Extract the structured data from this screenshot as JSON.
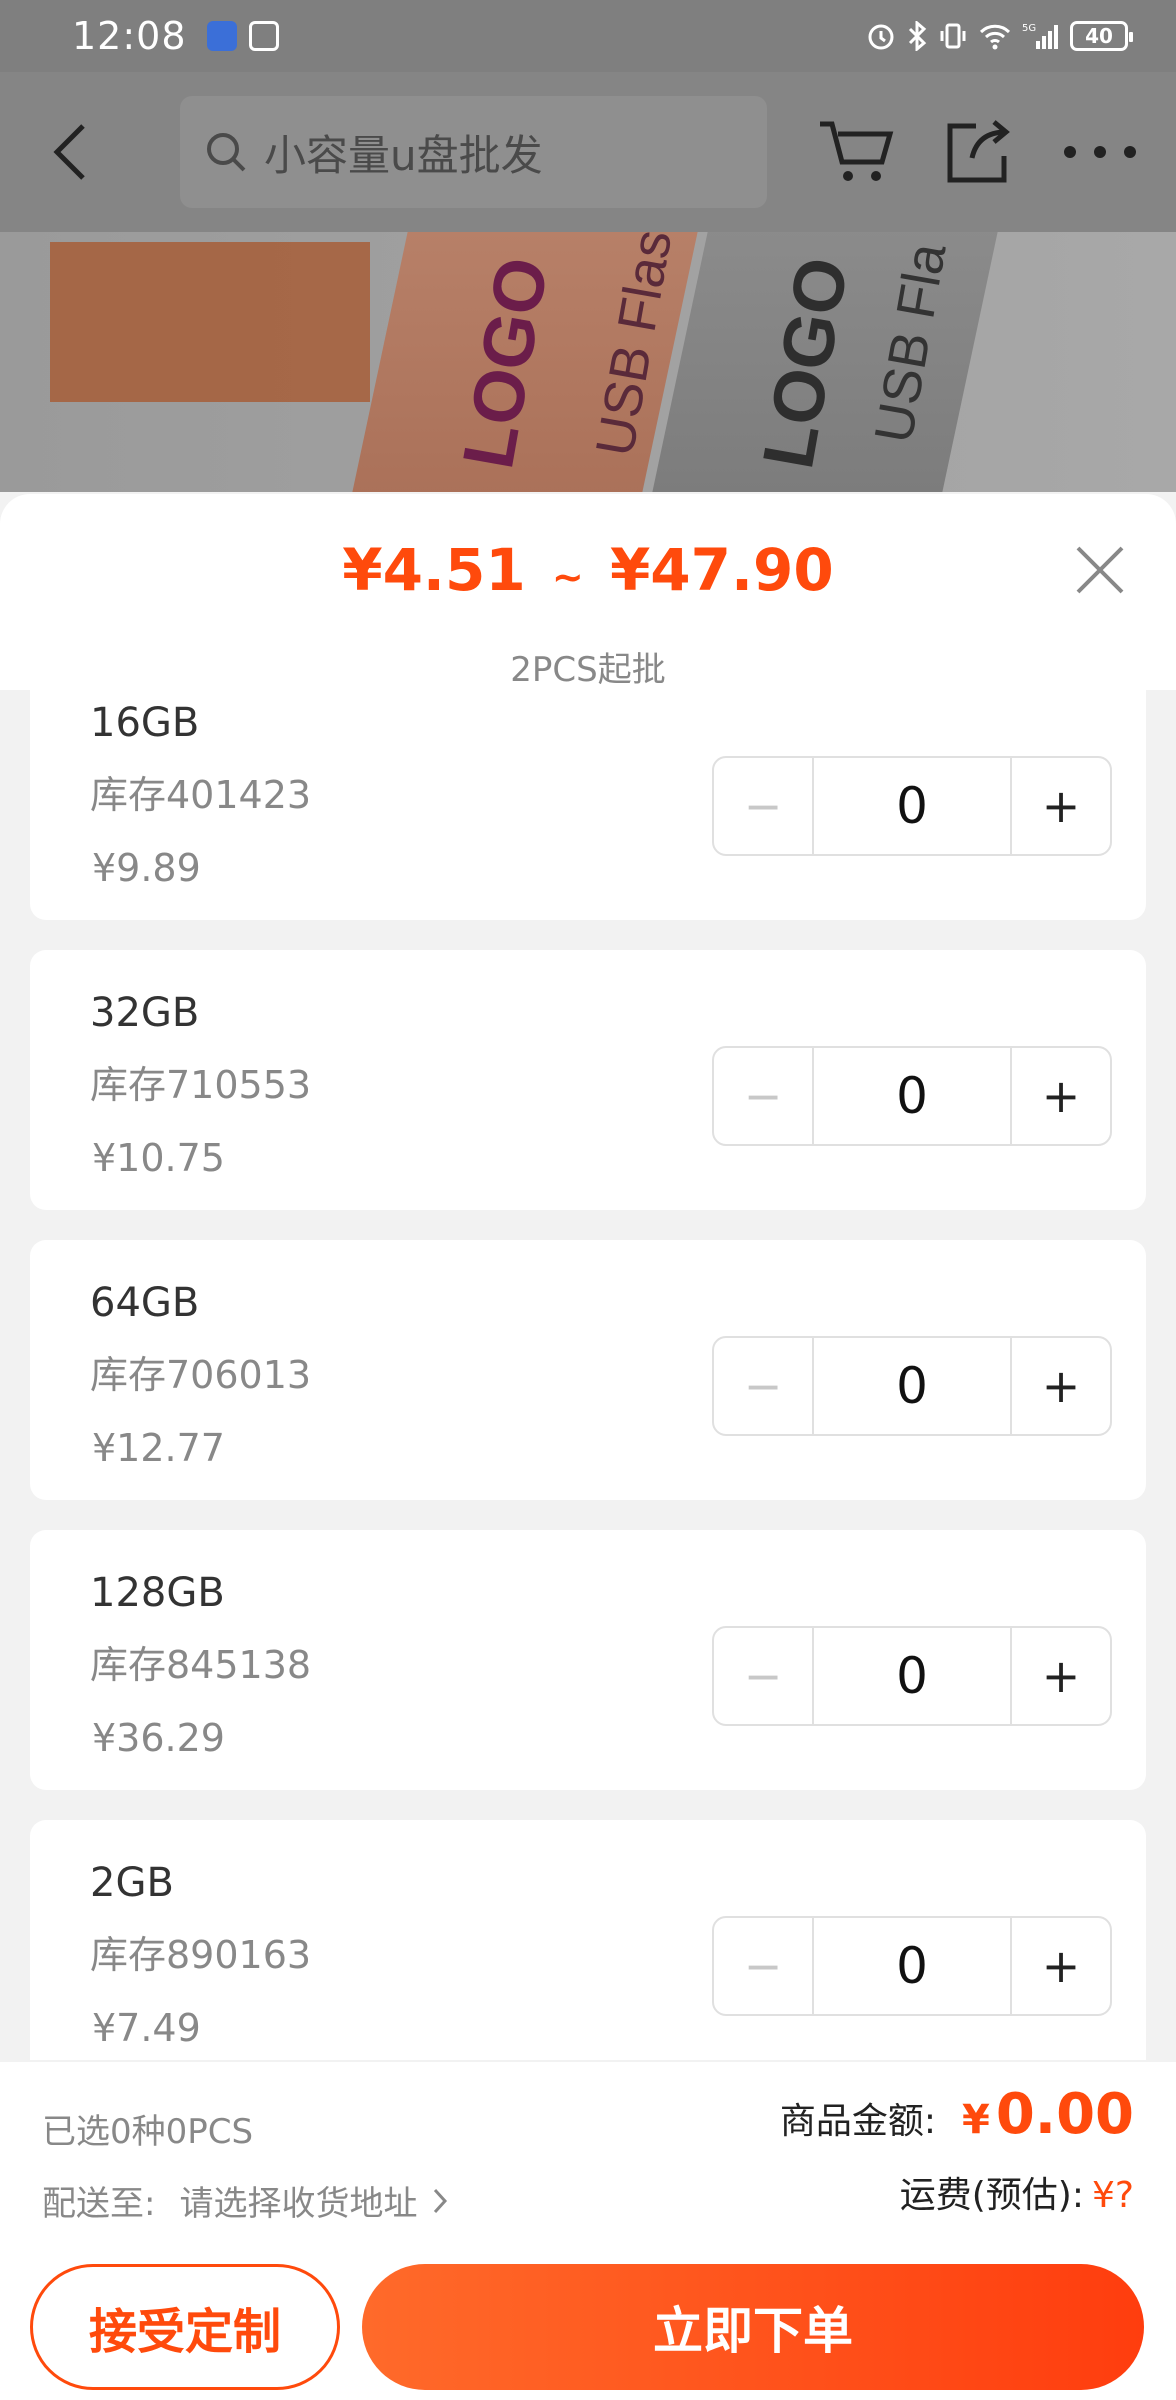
{
  "status_bar": {
    "time": "12:08",
    "battery": "40",
    "network": "5G"
  },
  "header": {
    "search_placeholder": "小容量u盘批发"
  },
  "product_image": {
    "label_1": "LOGO",
    "sub_1": "USB Flas",
    "label_2": "LOGO",
    "sub_2": "USB Fla"
  },
  "sheet": {
    "price_min": "¥4.51",
    "price_sep": "~",
    "price_max": "¥47.90",
    "min_order": "2PCS起批"
  },
  "items": [
    {
      "name": "16GB",
      "stock": "库存401423",
      "price": "¥9.89",
      "qty": "0"
    },
    {
      "name": "32GB",
      "stock": "库存710553",
      "price": "¥10.75",
      "qty": "0"
    },
    {
      "name": "64GB",
      "stock": "库存706013",
      "price": "¥12.77",
      "qty": "0"
    },
    {
      "name": "128GB",
      "stock": "库存845138",
      "price": "¥36.29",
      "qty": "0"
    },
    {
      "name": "2GB",
      "stock": "库存890163",
      "price": "¥7.49",
      "qty": "0"
    }
  ],
  "stepper": {
    "minus": "−",
    "plus": "+"
  },
  "footer": {
    "selected": "已选0种0PCS",
    "ship_label": "配送至:",
    "ship_address": "请选择收货地址",
    "amount_label": "商品金额:",
    "amount_currency": "¥",
    "amount_value": "0.00",
    "freight_label": "运费(预估):",
    "freight_value": "¥?",
    "btn_custom": "接受定制",
    "btn_order": "立即下单"
  },
  "colors": {
    "accent": "#ff4a0c"
  }
}
